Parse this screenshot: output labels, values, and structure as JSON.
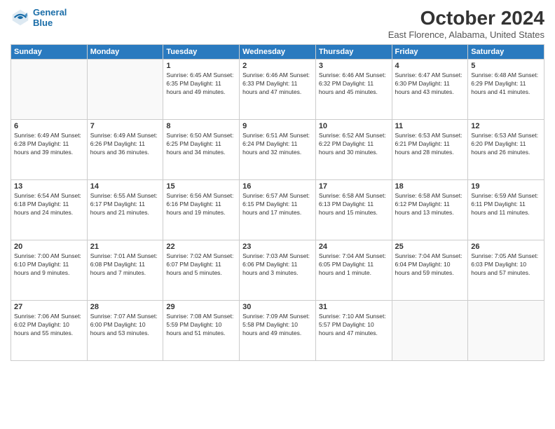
{
  "logo": {
    "line1": "General",
    "line2": "Blue"
  },
  "header": {
    "title": "October 2024",
    "location": "East Florence, Alabama, United States"
  },
  "days_of_week": [
    "Sunday",
    "Monday",
    "Tuesday",
    "Wednesday",
    "Thursday",
    "Friday",
    "Saturday"
  ],
  "weeks": [
    [
      {
        "day": "",
        "info": ""
      },
      {
        "day": "",
        "info": ""
      },
      {
        "day": "1",
        "info": "Sunrise: 6:45 AM\nSunset: 6:35 PM\nDaylight: 11 hours and 49 minutes."
      },
      {
        "day": "2",
        "info": "Sunrise: 6:46 AM\nSunset: 6:33 PM\nDaylight: 11 hours and 47 minutes."
      },
      {
        "day": "3",
        "info": "Sunrise: 6:46 AM\nSunset: 6:32 PM\nDaylight: 11 hours and 45 minutes."
      },
      {
        "day": "4",
        "info": "Sunrise: 6:47 AM\nSunset: 6:30 PM\nDaylight: 11 hours and 43 minutes."
      },
      {
        "day": "5",
        "info": "Sunrise: 6:48 AM\nSunset: 6:29 PM\nDaylight: 11 hours and 41 minutes."
      }
    ],
    [
      {
        "day": "6",
        "info": "Sunrise: 6:49 AM\nSunset: 6:28 PM\nDaylight: 11 hours and 39 minutes."
      },
      {
        "day": "7",
        "info": "Sunrise: 6:49 AM\nSunset: 6:26 PM\nDaylight: 11 hours and 36 minutes."
      },
      {
        "day": "8",
        "info": "Sunrise: 6:50 AM\nSunset: 6:25 PM\nDaylight: 11 hours and 34 minutes."
      },
      {
        "day": "9",
        "info": "Sunrise: 6:51 AM\nSunset: 6:24 PM\nDaylight: 11 hours and 32 minutes."
      },
      {
        "day": "10",
        "info": "Sunrise: 6:52 AM\nSunset: 6:22 PM\nDaylight: 11 hours and 30 minutes."
      },
      {
        "day": "11",
        "info": "Sunrise: 6:53 AM\nSunset: 6:21 PM\nDaylight: 11 hours and 28 minutes."
      },
      {
        "day": "12",
        "info": "Sunrise: 6:53 AM\nSunset: 6:20 PM\nDaylight: 11 hours and 26 minutes."
      }
    ],
    [
      {
        "day": "13",
        "info": "Sunrise: 6:54 AM\nSunset: 6:18 PM\nDaylight: 11 hours and 24 minutes."
      },
      {
        "day": "14",
        "info": "Sunrise: 6:55 AM\nSunset: 6:17 PM\nDaylight: 11 hours and 21 minutes."
      },
      {
        "day": "15",
        "info": "Sunrise: 6:56 AM\nSunset: 6:16 PM\nDaylight: 11 hours and 19 minutes."
      },
      {
        "day": "16",
        "info": "Sunrise: 6:57 AM\nSunset: 6:15 PM\nDaylight: 11 hours and 17 minutes."
      },
      {
        "day": "17",
        "info": "Sunrise: 6:58 AM\nSunset: 6:13 PM\nDaylight: 11 hours and 15 minutes."
      },
      {
        "day": "18",
        "info": "Sunrise: 6:58 AM\nSunset: 6:12 PM\nDaylight: 11 hours and 13 minutes."
      },
      {
        "day": "19",
        "info": "Sunrise: 6:59 AM\nSunset: 6:11 PM\nDaylight: 11 hours and 11 minutes."
      }
    ],
    [
      {
        "day": "20",
        "info": "Sunrise: 7:00 AM\nSunset: 6:10 PM\nDaylight: 11 hours and 9 minutes."
      },
      {
        "day": "21",
        "info": "Sunrise: 7:01 AM\nSunset: 6:08 PM\nDaylight: 11 hours and 7 minutes."
      },
      {
        "day": "22",
        "info": "Sunrise: 7:02 AM\nSunset: 6:07 PM\nDaylight: 11 hours and 5 minutes."
      },
      {
        "day": "23",
        "info": "Sunrise: 7:03 AM\nSunset: 6:06 PM\nDaylight: 11 hours and 3 minutes."
      },
      {
        "day": "24",
        "info": "Sunrise: 7:04 AM\nSunset: 6:05 PM\nDaylight: 11 hours and 1 minute."
      },
      {
        "day": "25",
        "info": "Sunrise: 7:04 AM\nSunset: 6:04 PM\nDaylight: 10 hours and 59 minutes."
      },
      {
        "day": "26",
        "info": "Sunrise: 7:05 AM\nSunset: 6:03 PM\nDaylight: 10 hours and 57 minutes."
      }
    ],
    [
      {
        "day": "27",
        "info": "Sunrise: 7:06 AM\nSunset: 6:02 PM\nDaylight: 10 hours and 55 minutes."
      },
      {
        "day": "28",
        "info": "Sunrise: 7:07 AM\nSunset: 6:00 PM\nDaylight: 10 hours and 53 minutes."
      },
      {
        "day": "29",
        "info": "Sunrise: 7:08 AM\nSunset: 5:59 PM\nDaylight: 10 hours and 51 minutes."
      },
      {
        "day": "30",
        "info": "Sunrise: 7:09 AM\nSunset: 5:58 PM\nDaylight: 10 hours and 49 minutes."
      },
      {
        "day": "31",
        "info": "Sunrise: 7:10 AM\nSunset: 5:57 PM\nDaylight: 10 hours and 47 minutes."
      },
      {
        "day": "",
        "info": ""
      },
      {
        "day": "",
        "info": ""
      }
    ]
  ]
}
